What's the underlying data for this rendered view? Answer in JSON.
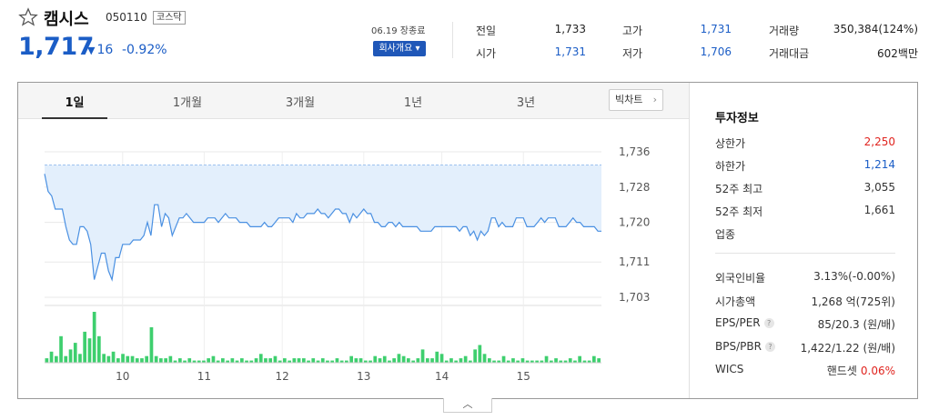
{
  "stock": {
    "name": "캠시스",
    "code": "050110",
    "market": "코스닥",
    "price": "1,717",
    "change": "16",
    "change_rate": "-0.92%",
    "date_status": "06.19 장종료",
    "company_button": "회사개요"
  },
  "quotes": [
    {
      "label": "전일",
      "value": "1,733",
      "color": "#333333"
    },
    {
      "label": "시가",
      "value": "1,731",
      "color": "#1b5dc6"
    },
    {
      "label": "고가",
      "value": "1,731",
      "color": "#1b5dc6"
    },
    {
      "label": "저가",
      "value": "1,706",
      "color": "#1b5dc6"
    },
    {
      "label": "거래량",
      "value": "350,384(124%)",
      "color": "#333333"
    },
    {
      "label": "거래대금",
      "value": "602백만",
      "color": "#333333"
    }
  ],
  "tabs": [
    "1일",
    "1개월",
    "3개월",
    "1년",
    "3년"
  ],
  "active_tab": "1일",
  "bigchart_label": "빅차트",
  "invest_info": {
    "title": "투자정보",
    "rows": [
      {
        "label": "상한가",
        "value": "2,250",
        "color": "#e0241f"
      },
      {
        "label": "하한가",
        "value": "1,214",
        "color": "#1b5dc6"
      },
      {
        "label": "52주 최고",
        "value": "3,055",
        "color": "#333333"
      },
      {
        "label": "52주 최저",
        "value": "1,661",
        "color": "#333333"
      },
      {
        "label": "업종",
        "value": "",
        "color": "#333333"
      }
    ],
    "rows2": [
      {
        "label": "외국인비율",
        "value": "3.13%(-0.00%)",
        "help": false
      },
      {
        "label": "시가총액",
        "value": "1,268 억(725위)",
        "help": false
      },
      {
        "label": "EPS/PER",
        "value": "85/20.3 (원/배)",
        "help": true
      },
      {
        "label": "BPS/PBR",
        "value": "1,422/1.22 (원/배)",
        "help": true
      },
      {
        "label": "WICS",
        "value": "핸드셋",
        "extra": "0.06%",
        "help": false
      }
    ]
  },
  "collapse_icon": "chevron-up-icon",
  "colors": {
    "up": "#e0241f",
    "down": "#1b5dc6",
    "volume": "#3ecf6e",
    "line": "#4a90e2",
    "fill": "#e3effc"
  },
  "chart_data": {
    "type": "line",
    "title": "",
    "x_ticks": [
      "10",
      "11",
      "12",
      "13",
      "14",
      "15"
    ],
    "y_ticks": [
      1736,
      1728,
      1720,
      1711,
      1703
    ],
    "ylim": [
      1703,
      1736
    ],
    "reference": 1733,
    "price_series": [
      1731,
      1727,
      1726,
      1723,
      1723,
      1723,
      1719,
      1716,
      1715,
      1715,
      1719,
      1719,
      1718,
      1715,
      1707,
      1710,
      1713,
      1713,
      1709,
      1707,
      1712,
      1712,
      1715,
      1715,
      1715,
      1716,
      1716,
      1716,
      1717,
      1720,
      1717,
      1724,
      1724,
      1719,
      1722,
      1721,
      1717,
      1719,
      1721,
      1721,
      1722,
      1721,
      1720,
      1720,
      1720,
      1720,
      1721,
      1721,
      1721,
      1720,
      1721,
      1722,
      1721,
      1721,
      1721,
      1720,
      1720,
      1720,
      1719,
      1719,
      1719,
      1719,
      1720,
      1719,
      1719,
      1720,
      1721,
      1721,
      1721,
      1721,
      1720,
      1722,
      1721,
      1721,
      1722,
      1722,
      1722,
      1723,
      1722,
      1722,
      1721,
      1722,
      1723,
      1723,
      1722,
      1722,
      1720,
      1722,
      1721,
      1722,
      1723,
      1722,
      1722,
      1720,
      1720,
      1719,
      1719,
      1720,
      1720,
      1719,
      1720,
      1719,
      1719,
      1719,
      1719,
      1719,
      1718,
      1718,
      1718,
      1718,
      1719,
      1719,
      1719,
      1719,
      1719,
      1719,
      1719,
      1718,
      1719,
      1719,
      1717,
      1718,
      1716,
      1718,
      1717,
      1718,
      1721,
      1721,
      1719,
      1720,
      1719,
      1719,
      1719,
      1721,
      1721,
      1721,
      1719,
      1719,
      1719,
      1720,
      1721,
      1720,
      1721,
      1721,
      1721,
      1719,
      1719,
      1719,
      1720,
      1721,
      1720,
      1720,
      1719,
      1719,
      1719,
      1719,
      1718,
      1718
    ],
    "volume_series": [
      2,
      5,
      3,
      12,
      3,
      6,
      9,
      4,
      14,
      11,
      23,
      12,
      4,
      3,
      5,
      2,
      4,
      3,
      3,
      2,
      2,
      3,
      16,
      3,
      2,
      2,
      3,
      1,
      2,
      1,
      2,
      1,
      1,
      1,
      2,
      3,
      1,
      2,
      1,
      2,
      1,
      2,
      1,
      1,
      2,
      4,
      2,
      2,
      3,
      1,
      2,
      1,
      2,
      2,
      2,
      1,
      2,
      1,
      2,
      1,
      1,
      2,
      1,
      1,
      3,
      2,
      2,
      1,
      1,
      3,
      2,
      3,
      1,
      2,
      4,
      3,
      2,
      1,
      2,
      6,
      2,
      2,
      5,
      4,
      1,
      2,
      1,
      2,
      3,
      1,
      6,
      8,
      4,
      2,
      1,
      1,
      3,
      1,
      2,
      1,
      2,
      1,
      1,
      1,
      1,
      3,
      1,
      2,
      1,
      1,
      2,
      1,
      3,
      1,
      1,
      3,
      2
    ]
  }
}
